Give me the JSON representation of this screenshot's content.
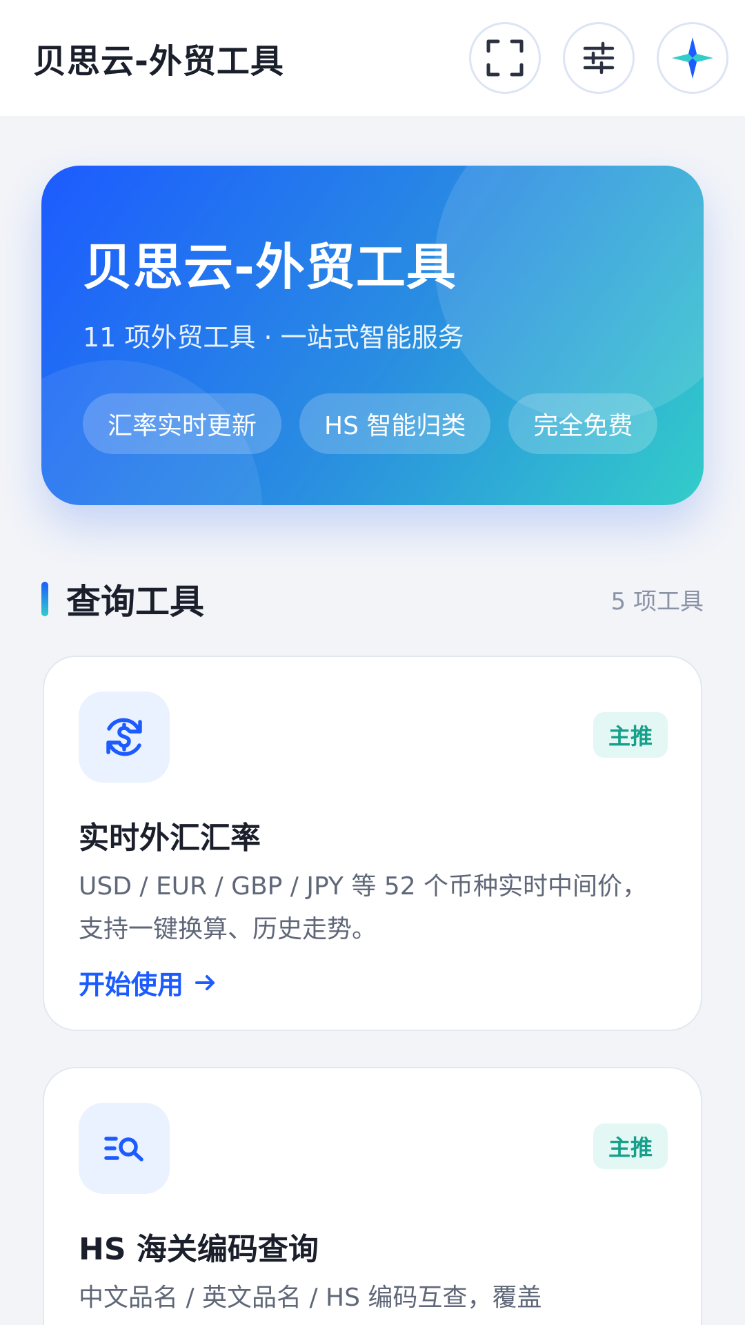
{
  "header": {
    "title": "贝思云-外贸工具",
    "actions": [
      {
        "icon": "fullscreen-icon"
      },
      {
        "icon": "sliders-icon"
      },
      {
        "icon": "app-logo-icon"
      }
    ]
  },
  "hero": {
    "title": "贝思云-外贸工具",
    "subtitle": "11 项外贸工具 · 一站式智能服务",
    "tags": [
      "汇率实时更新",
      "HS 智能归类",
      "完全免费"
    ]
  },
  "section": {
    "title": "查询工具",
    "count": "5 项工具"
  },
  "tools": [
    {
      "icon": "currency-exchange-icon",
      "badge": "主推",
      "title": "实时外汇汇率",
      "description": "USD / EUR / GBP / JPY 等 52 个币种实时中间价，支持一键换算、历史走势。",
      "link": "开始使用"
    },
    {
      "icon": "list-search-icon",
      "badge": "主推",
      "title": "HS 海关编码查询",
      "description": "中文品名 / 英文品名 / HS 编码互查，覆盖"
    }
  ],
  "colors": {
    "primary": "#1C5BFF",
    "teal": "#33CDC9",
    "badge_text": "#14A08A",
    "background": "#F2F4F8"
  }
}
